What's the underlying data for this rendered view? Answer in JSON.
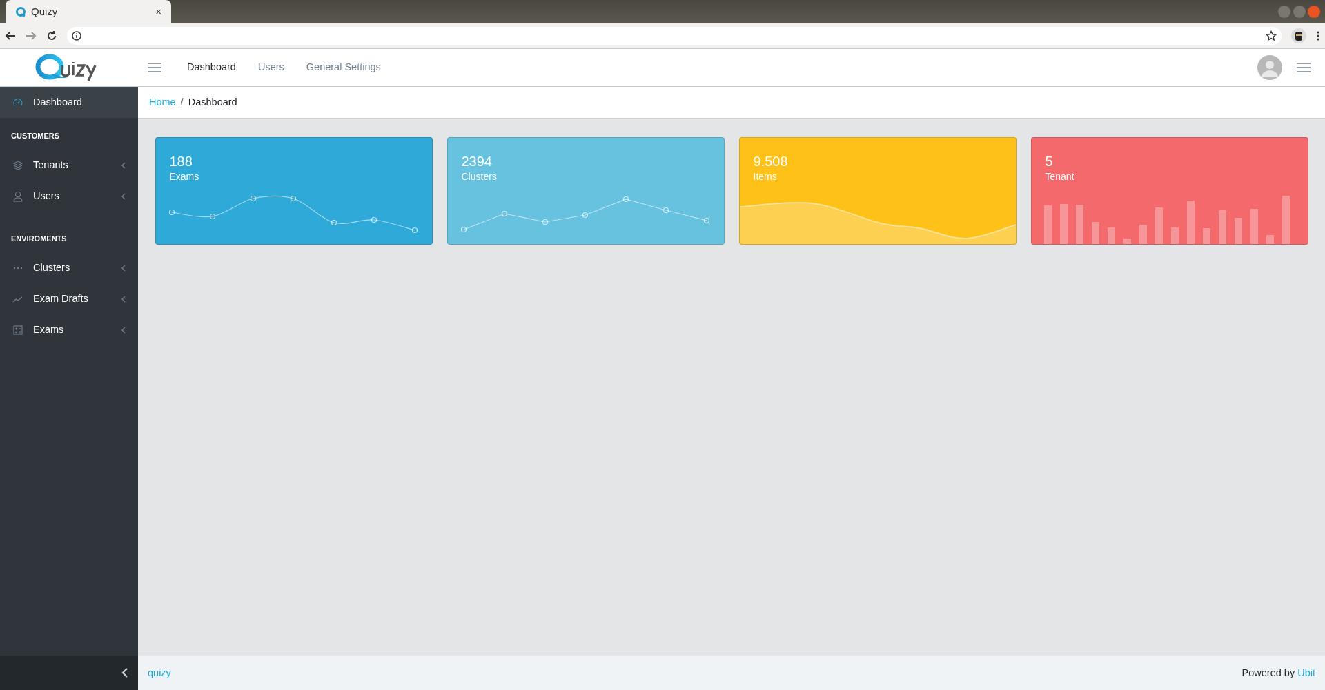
{
  "browser": {
    "tab_title": "Quizy",
    "tab_close": "×"
  },
  "navbar": {
    "links": [
      {
        "label": "Dashboard",
        "selected": true
      },
      {
        "label": "Users",
        "selected": false
      },
      {
        "label": "General Settings",
        "selected": false
      }
    ]
  },
  "sidebar": {
    "items": [
      {
        "kind": "link",
        "label": "Dashboard",
        "selected": true
      },
      {
        "kind": "heading",
        "label": "CUSTOMERS"
      },
      {
        "kind": "link",
        "label": "Tenants",
        "selected": false
      },
      {
        "kind": "link",
        "label": "Users",
        "selected": false
      },
      {
        "kind": "heading",
        "label": "ENVIROMENTS"
      },
      {
        "kind": "link",
        "label": "Clusters",
        "selected": false
      },
      {
        "kind": "link",
        "label": "Exam Drafts",
        "selected": false
      },
      {
        "kind": "link",
        "label": "Exams",
        "selected": false
      }
    ]
  },
  "breadcrumb": [
    {
      "label": "Home",
      "kind": "link"
    },
    {
      "label": "/",
      "kind": "separator"
    },
    {
      "label": "Dashboard",
      "kind": "current"
    }
  ],
  "cards": [
    {
      "value": "188",
      "label": "Exams",
      "kind": "curve",
      "color": "#2fa9d8"
    },
    {
      "value": "2394",
      "label": "Clusters",
      "kind": "polyline",
      "color": "#67c2df"
    },
    {
      "value": "9.508",
      "label": "Items",
      "kind": "area",
      "color": "#fdc117"
    },
    {
      "value": "5",
      "label": "Tenant",
      "kind": "bars",
      "color": "#f4696c"
    }
  ],
  "footer": {
    "left": "quizy",
    "right_text": "Powered by",
    "right_link": "Ubit"
  }
}
